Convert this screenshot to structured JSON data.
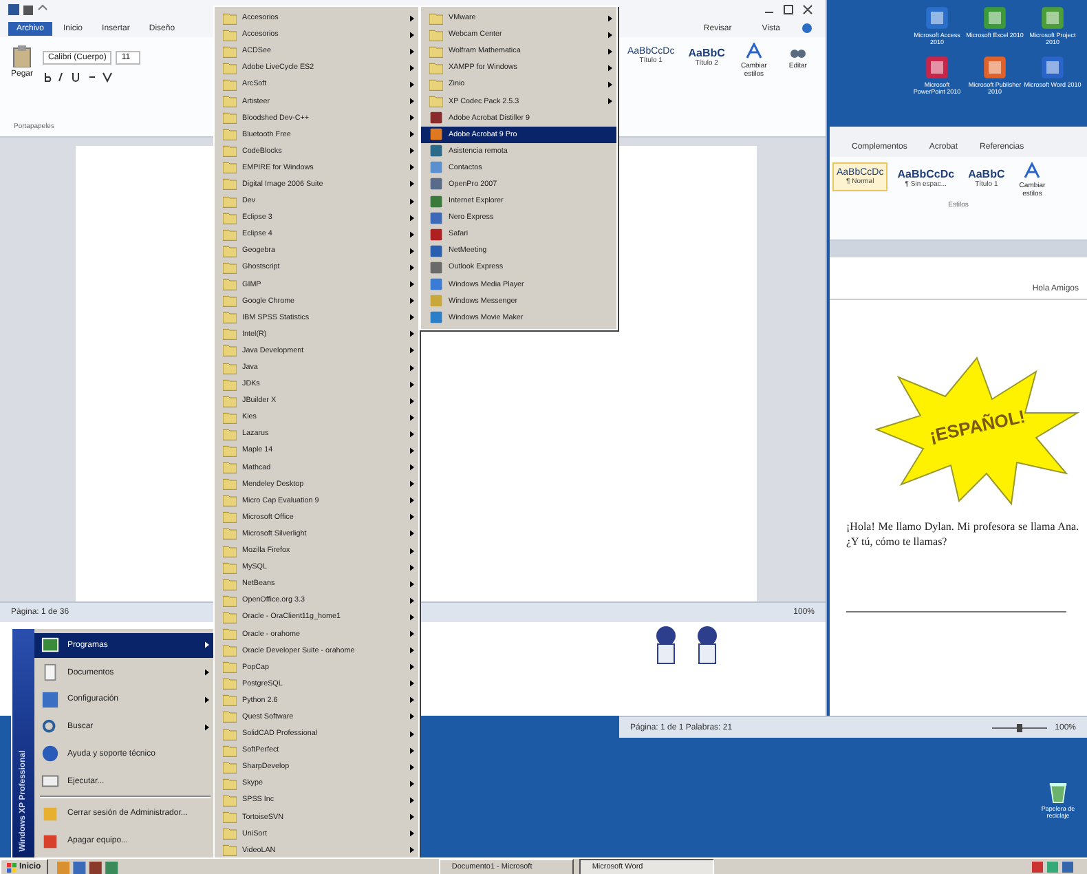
{
  "left_window": {
    "tabs": [
      {
        "label": "Archivo",
        "selected": true
      },
      {
        "label": "Inicio",
        "selected": false
      },
      {
        "label": "Insertar",
        "selected": false
      },
      {
        "label": "Diseño",
        "selected": false
      }
    ],
    "tabs_right": [
      {
        "label": "Revisar",
        "selected": false
      },
      {
        "label": "Vista",
        "selected": false
      }
    ],
    "paste_label": "Pegar",
    "font_name": "Calibri (Cuerpo)",
    "font_size": "11",
    "clipboard_label": "Portapapeles",
    "styles": [
      {
        "sample": "AaBbCcDc",
        "name": "Título 1"
      },
      {
        "sample": "AaBbC",
        "name": "Título 2"
      }
    ],
    "change_styles": "Cambiar estilos",
    "edit_label": "Editar",
    "status_page": "Página: 1 de 36",
    "status_zoom": "100%"
  },
  "desktop_icons": [
    {
      "label": "Microsoft Access 2010",
      "color": "#2a6fc9"
    },
    {
      "label": "Microsoft Excel 2010",
      "color": "#3d9a3a"
    },
    {
      "label": "Microsoft Project 2010",
      "color": "#4c9e3a"
    },
    {
      "label": "Microsoft PowerPoint 2010",
      "color": "#c8254a"
    },
    {
      "label": "Microsoft Publisher 2010",
      "color": "#e0622a"
    },
    {
      "label": "Microsoft Word 2010",
      "color": "#2b64c8"
    }
  ],
  "right_window": {
    "tabs": [
      {
        "label": "Complementos",
        "selected": false
      },
      {
        "label": "Acrobat",
        "selected": false
      },
      {
        "label": "Referencias",
        "selected": false
      }
    ],
    "styles": [
      {
        "sample": "AaBbCcDc",
        "name": "¶ Normal",
        "selected": true
      },
      {
        "sample": "AaBbCcDc",
        "name": "¶ Sin espac...",
        "selected": false
      },
      {
        "sample": "AaBbC",
        "name": "Título 1",
        "selected": false
      }
    ],
    "change_styles": "Cambiar estilos",
    "styles_group": "Estilos",
    "header_text": "Hola Amigos",
    "star_text": "¡ESPAÑOL!",
    "paragraph": "¡Hola! Me llamo Dylan. Mi profesora se llama Ana. ¿Y tú, cómo te llamas?",
    "status": "Página: 1 de 1   Palabras: 21",
    "zoom": "100%"
  },
  "start_menu": {
    "banner": "Windows XP Professional",
    "items": [
      {
        "label": "Programas",
        "submenu": true,
        "selected": true,
        "separator_before": false
      },
      {
        "label": "Documentos",
        "submenu": true,
        "selected": false,
        "separator_before": false
      },
      {
        "label": "Configuración",
        "submenu": true,
        "selected": false,
        "separator_before": false
      },
      {
        "label": "Buscar",
        "submenu": true,
        "selected": false,
        "separator_before": false
      },
      {
        "label": "Ayuda y soporte técnico",
        "submenu": false,
        "selected": false,
        "separator_before": false
      },
      {
        "label": "Ejecutar...",
        "submenu": false,
        "selected": false,
        "separator_before": false
      },
      {
        "label": "Cerrar sesión de Administrador...",
        "submenu": false,
        "selected": false,
        "separator_before": true
      },
      {
        "label": "Apagar equipo...",
        "submenu": false,
        "selected": false,
        "separator_before": false
      }
    ]
  },
  "programs_menu": {
    "columns": [
      {
        "items": [
          {
            "label": "Accesorios",
            "kind": "folder",
            "submenu": true,
            "selected": false
          },
          {
            "label": "Accesorios",
            "kind": "folder",
            "submenu": true,
            "selected": false
          },
          {
            "label": "ACDSee",
            "kind": "folder",
            "submenu": true,
            "selected": false
          },
          {
            "label": "Adobe LiveCycle ES2",
            "kind": "folder",
            "submenu": true,
            "selected": false
          },
          {
            "label": "ArcSoft",
            "kind": "folder",
            "submenu": true,
            "selected": false
          },
          {
            "label": "Artisteer",
            "kind": "folder",
            "submenu": true,
            "selected": false
          },
          {
            "label": "Bloodshed Dev-C++",
            "kind": "folder",
            "submenu": true,
            "selected": false
          },
          {
            "label": "Bluetooth Free",
            "kind": "folder",
            "submenu": true,
            "selected": false
          },
          {
            "label": "CodeBlocks",
            "kind": "folder",
            "submenu": true,
            "selected": false
          },
          {
            "label": "EMPIRE for Windows",
            "kind": "folder",
            "submenu": true,
            "selected": false
          },
          {
            "label": "Digital Image 2006 Suite",
            "kind": "folder",
            "submenu": true,
            "selected": false
          },
          {
            "label": "Dev",
            "kind": "folder",
            "submenu": true,
            "selected": false
          },
          {
            "label": "Eclipse 3",
            "kind": "folder",
            "submenu": true,
            "selected": false
          },
          {
            "label": "Eclipse 4",
            "kind": "folder",
            "submenu": true,
            "selected": false
          },
          {
            "label": "Geogebra",
            "kind": "folder",
            "submenu": true,
            "selected": false
          },
          {
            "label": "Ghostscript",
            "kind": "folder",
            "submenu": true,
            "selected": false
          },
          {
            "label": "GIMP",
            "kind": "folder",
            "submenu": true,
            "selected": false
          },
          {
            "label": "Google Chrome",
            "kind": "folder",
            "submenu": true,
            "selected": false
          },
          {
            "label": "IBM SPSS Statistics",
            "kind": "folder",
            "submenu": true,
            "selected": false
          },
          {
            "label": "Intel(R)",
            "kind": "folder",
            "submenu": true,
            "selected": false
          },
          {
            "label": "Java Development",
            "kind": "folder",
            "submenu": true,
            "selected": false
          },
          {
            "label": "Java",
            "kind": "folder",
            "submenu": true,
            "selected": false
          },
          {
            "label": "JDKs",
            "kind": "folder",
            "submenu": true,
            "selected": false
          },
          {
            "label": "JBuilder X",
            "kind": "folder",
            "submenu": true,
            "selected": false
          },
          {
            "label": "Kies",
            "kind": "folder",
            "submenu": true,
            "selected": false
          },
          {
            "label": "Lazarus",
            "kind": "folder",
            "submenu": true,
            "selected": false
          },
          {
            "label": "Maple 14",
            "kind": "folder",
            "submenu": true,
            "selected": false
          },
          {
            "label": "Mathcad",
            "kind": "folder",
            "submenu": true,
            "selected": false
          },
          {
            "label": "Mendeley Desktop",
            "kind": "folder",
            "submenu": true,
            "selected": false
          },
          {
            "label": "Micro Cap Evaluation 9",
            "kind": "folder",
            "submenu": true,
            "selected": false
          },
          {
            "label": "Microsoft Office",
            "kind": "folder",
            "submenu": true,
            "selected": false
          },
          {
            "label": "Microsoft Silverlight",
            "kind": "folder",
            "submenu": true,
            "selected": false
          },
          {
            "label": "Mozilla Firefox",
            "kind": "folder",
            "submenu": true,
            "selected": false
          },
          {
            "label": "MySQL",
            "kind": "folder",
            "submenu": true,
            "selected": false
          },
          {
            "label": "NetBeans",
            "kind": "folder",
            "submenu": true,
            "selected": false
          },
          {
            "label": "OpenOffice.org 3.3",
            "kind": "folder",
            "submenu": true,
            "selected": false
          },
          {
            "label": "Oracle - OraClient11g_home1",
            "kind": "folder",
            "submenu": true,
            "selected": false
          },
          {
            "label": "Oracle - orahome",
            "kind": "folder",
            "submenu": true,
            "selected": false
          },
          {
            "label": "Oracle Developer Suite - orahome",
            "kind": "folder",
            "submenu": true,
            "selected": false
          },
          {
            "label": "PopCap",
            "kind": "folder",
            "submenu": true,
            "selected": false
          },
          {
            "label": "PostgreSQL",
            "kind": "folder",
            "submenu": true,
            "selected": false
          },
          {
            "label": "Python 2.6",
            "kind": "folder",
            "submenu": true,
            "selected": false
          },
          {
            "label": "Quest Software",
            "kind": "folder",
            "submenu": true,
            "selected": false
          },
          {
            "label": "SolidCAD Professional",
            "kind": "folder",
            "submenu": true,
            "selected": false
          },
          {
            "label": "SoftPerfect",
            "kind": "folder",
            "submenu": true,
            "selected": false
          },
          {
            "label": "SharpDevelop",
            "kind": "folder",
            "submenu": true,
            "selected": false
          },
          {
            "label": "Skype",
            "kind": "folder",
            "submenu": true,
            "selected": false
          },
          {
            "label": "SPSS Inc",
            "kind": "folder",
            "submenu": true,
            "selected": false
          },
          {
            "label": "TortoiseSVN",
            "kind": "folder",
            "submenu": true,
            "selected": false
          },
          {
            "label": "UniSort",
            "kind": "folder",
            "submenu": true,
            "selected": false
          },
          {
            "label": "VideoLAN",
            "kind": "folder",
            "submenu": true,
            "selected": false
          }
        ]
      },
      {
        "items": [
          {
            "label": "VMware",
            "kind": "folder",
            "submenu": true,
            "selected": false
          },
          {
            "label": "Webcam Center",
            "kind": "folder",
            "submenu": true,
            "selected": false
          },
          {
            "label": "Wolfram Mathematica",
            "kind": "folder",
            "submenu": true,
            "selected": false
          },
          {
            "label": "XAMPP for Windows",
            "kind": "folder",
            "submenu": true,
            "selected": false
          },
          {
            "label": "Zinio",
            "kind": "folder",
            "submenu": true,
            "selected": false
          },
          {
            "label": "XP Codec Pack 2.5.3",
            "kind": "folder",
            "submenu": true,
            "selected": false
          },
          {
            "label": "Adobe Acrobat Distiller 9",
            "kind": "app",
            "submenu": false,
            "selected": false
          },
          {
            "label": "Adobe Acrobat 9 Pro",
            "kind": "app",
            "submenu": false,
            "selected": true
          },
          {
            "label": "Asistencia remota",
            "kind": "app",
            "submenu": false,
            "selected": false
          },
          {
            "label": "Contactos",
            "kind": "app",
            "submenu": false,
            "selected": false
          },
          {
            "label": "OpenPro 2007",
            "kind": "app",
            "submenu": false,
            "selected": false
          },
          {
            "label": "Internet Explorer",
            "kind": "app",
            "submenu": false,
            "selected": false
          },
          {
            "label": "Nero Express",
            "kind": "app",
            "submenu": false,
            "selected": false
          },
          {
            "label": "Safari",
            "kind": "app",
            "submenu": false,
            "selected": false
          },
          {
            "label": "NetMeeting",
            "kind": "app",
            "submenu": false,
            "selected": false
          },
          {
            "label": "Outlook Express",
            "kind": "app",
            "submenu": false,
            "selected": false
          },
          {
            "label": "Windows Media Player",
            "kind": "app",
            "submenu": false,
            "selected": false
          },
          {
            "label": "Windows Messenger",
            "kind": "app",
            "submenu": false,
            "selected": false
          },
          {
            "label": "Windows Movie Maker",
            "kind": "app",
            "submenu": false,
            "selected": false
          }
        ]
      }
    ]
  },
  "recycle_bin": "Papelera de reciclaje",
  "taskbar": {
    "start": "Inicio",
    "tasks": [
      {
        "label": "Documento1 - Microsoft",
        "selected": false
      },
      {
        "label": "Microsoft Word",
        "selected": true
      }
    ]
  }
}
